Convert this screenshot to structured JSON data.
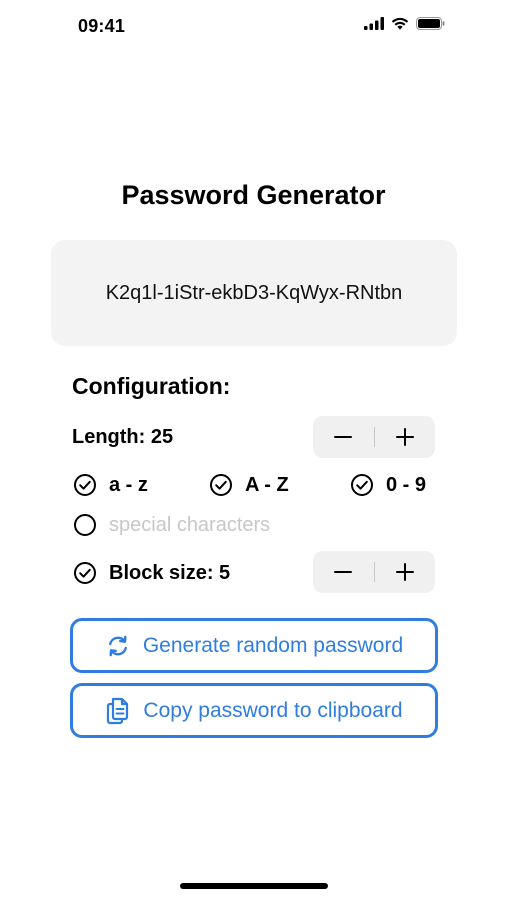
{
  "status_bar": {
    "time": "09:41"
  },
  "title": "Password Generator",
  "password": "K2q1l-1iStr-ekbD3-KqWyx-RNtbn",
  "config": {
    "heading": "Configuration:",
    "length_label": "Length: 25",
    "options": [
      {
        "label": "a - z",
        "checked": true
      },
      {
        "label": "A - Z",
        "checked": true
      },
      {
        "label": "0 - 9",
        "checked": true
      },
      {
        "label": "special characters",
        "checked": false
      }
    ],
    "block_size_label": "Block size: 5",
    "block_size_checked": true
  },
  "stepper": {
    "minus": "−",
    "plus": "+"
  },
  "buttons": {
    "generate": "Generate random password",
    "copy": "Copy password to clipboard"
  },
  "colors": {
    "accent": "#2f7de1",
    "muted": "#c7c7c9",
    "surface": "#f3f3f3"
  }
}
